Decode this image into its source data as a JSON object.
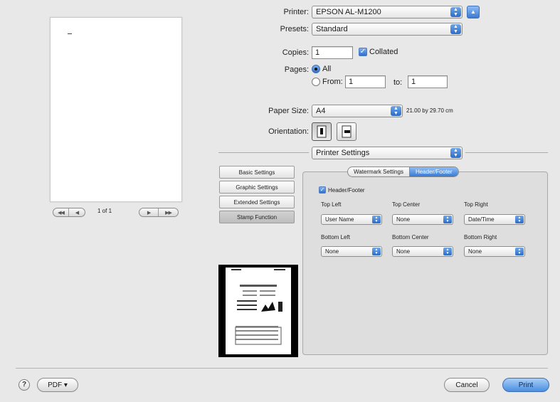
{
  "window": {
    "accent": "#3a7ad2"
  },
  "preview": {
    "page_counter": "1 of 1",
    "nav": [
      "◀◀",
      "◀",
      "▶",
      "▶▶"
    ]
  },
  "printer": {
    "label": "Printer:",
    "value": "EPSON AL-M1200",
    "expand_icon": "disclosure-up-icon"
  },
  "presets": {
    "label": "Presets:",
    "value": "Standard"
  },
  "copies": {
    "label": "Copies:",
    "value": "1",
    "collated_label": "Collated",
    "collated_checked": true
  },
  "pages": {
    "label": "Pages:",
    "all_label": "All",
    "from_label": "From:",
    "from_value": "1",
    "to_label": "to:",
    "to_value": "1",
    "selected": "All"
  },
  "paper_size": {
    "label": "Paper Size:",
    "value": "A4",
    "dimensions": "21.00 by 29.70 cm"
  },
  "orientation": {
    "label": "Orientation:",
    "selected": "portrait"
  },
  "section_popup": {
    "value": "Printer Settings"
  },
  "side_tabs": [
    {
      "label": "Basic Settings"
    },
    {
      "label": "Graphic Settings"
    },
    {
      "label": "Extended Settings"
    },
    {
      "label": "Stamp Function",
      "selected": true
    }
  ],
  "subtabs": {
    "watermark": "Watermark Settings",
    "header_footer": "Header/Footer",
    "active": "Header/Footer"
  },
  "header_footer": {
    "enable_label": "Header/Footer",
    "enabled": true,
    "top_left": {
      "label": "Top Left",
      "value": "User Name"
    },
    "top_center": {
      "label": "Top Center",
      "value": "None"
    },
    "top_right": {
      "label": "Top Right",
      "value": "Date/Time"
    },
    "bottom_left": {
      "label": "Bottom Left",
      "value": "None"
    },
    "bottom_center": {
      "label": "Bottom Center",
      "value": "None"
    },
    "bottom_right": {
      "label": "Bottom Right",
      "value": "None"
    }
  },
  "footer": {
    "help": "?",
    "pdf": "PDF ▾",
    "cancel": "Cancel",
    "print": "Print"
  }
}
